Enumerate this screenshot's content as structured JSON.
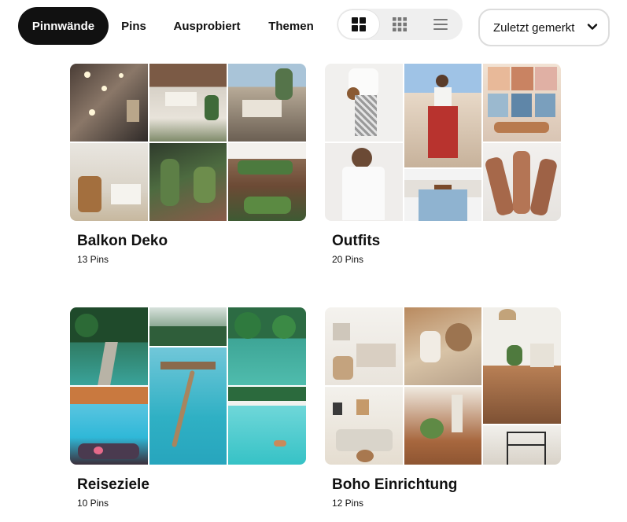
{
  "tabs": [
    {
      "label": "Pinnwände",
      "active": true
    },
    {
      "label": "Pins",
      "active": false
    },
    {
      "label": "Ausprobiert",
      "active": false
    },
    {
      "label": "Themen",
      "active": false
    }
  ],
  "view_options": [
    {
      "icon": "grid-large-icon",
      "active": true
    },
    {
      "icon": "grid-compact-icon",
      "active": false
    },
    {
      "icon": "list-icon",
      "active": false
    }
  ],
  "sort": {
    "label": "Zuletzt gemerkt",
    "icon": "chevron-down-icon"
  },
  "boards": [
    {
      "title": "Balkon Deko",
      "count": "13 Pins"
    },
    {
      "title": "Outfits",
      "count": "20 Pins"
    },
    {
      "title": "Reiseziele",
      "count": "10 Pins"
    },
    {
      "title": "Boho Einrichtung",
      "count": "12 Pins"
    }
  ],
  "colors": {
    "active_tab": "#111111",
    "toggle_bg": "#efefef",
    "sort_border": "#dcdcdc"
  }
}
